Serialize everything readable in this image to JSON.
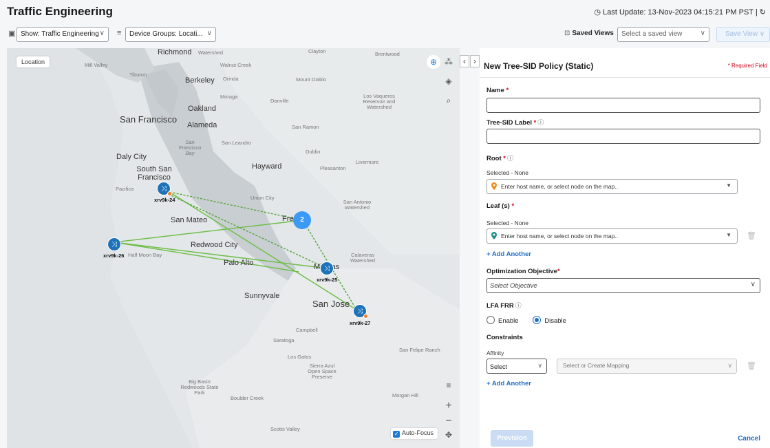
{
  "header": {
    "title": "Traffic Engineering",
    "last_update": "◷ Last Update: 13-Nov-2023 04:15:21 PM PST | ↻"
  },
  "toolbar": {
    "show_filter": "Show: Traffic Engineering",
    "device_groups": "Device Groups: Locati...",
    "saved_views_label": "Saved Views",
    "saved_view_placeholder": "Select a saved view",
    "save_view_button": "Save View"
  },
  "map": {
    "location_chip": "Location",
    "auto_focus": "Auto-Focus",
    "cluster_count": "2",
    "places": [
      {
        "name": "Richmond",
        "size": "med"
      },
      {
        "name": "Watershed",
        "size": "small"
      },
      {
        "name": "Clayton",
        "size": "small"
      },
      {
        "name": "Brentwood",
        "size": "small"
      },
      {
        "name": "Mill Valley",
        "size": "small"
      },
      {
        "name": "Tiburon",
        "size": "small"
      },
      {
        "name": "Walnut Creek",
        "size": "small"
      },
      {
        "name": "Berkeley",
        "size": "med"
      },
      {
        "name": "Orinda",
        "size": "small"
      },
      {
        "name": "Mount Diablo",
        "size": "small"
      },
      {
        "name": "Moraga",
        "size": "small"
      },
      {
        "name": "Danville",
        "size": "small"
      },
      {
        "name": "Los Vaqueros Reservoir and Watershed",
        "size": "small"
      },
      {
        "name": "Oakland",
        "size": "med"
      },
      {
        "name": "San Francisco",
        "size": "big"
      },
      {
        "name": "Alameda",
        "size": "med"
      },
      {
        "name": "San Ramon",
        "size": "small"
      },
      {
        "name": "San Francisco Bay",
        "size": "small"
      },
      {
        "name": "San Leandro",
        "size": "small"
      },
      {
        "name": "Dublin",
        "size": "small"
      },
      {
        "name": "Livermore",
        "size": "small"
      },
      {
        "name": "Daly City",
        "size": "med"
      },
      {
        "name": "South San Francisco",
        "size": "med"
      },
      {
        "name": "Hayward",
        "size": "med"
      },
      {
        "name": "Pleasanton",
        "size": "small"
      },
      {
        "name": "Pacifica",
        "size": "small"
      },
      {
        "name": "Union City",
        "size": "small"
      },
      {
        "name": "San Antonio Watershed",
        "size": "small"
      },
      {
        "name": "San Mateo",
        "size": "med"
      },
      {
        "name": "Fremont",
        "size": "med"
      },
      {
        "name": "Redwood City",
        "size": "med"
      },
      {
        "name": "Half Moon Bay",
        "size": "small"
      },
      {
        "name": "Palo Alto",
        "size": "med"
      },
      {
        "name": "Milpitas",
        "size": "med"
      },
      {
        "name": "Calaveras Watershed",
        "size": "small"
      },
      {
        "name": "Sunnyvale",
        "size": "med"
      },
      {
        "name": "San Jose",
        "size": "big"
      },
      {
        "name": "Campbell",
        "size": "small"
      },
      {
        "name": "Saratoga",
        "size": "small"
      },
      {
        "name": "Los Gatos",
        "size": "small"
      },
      {
        "name": "San Felipe Ranch",
        "size": "small"
      },
      {
        "name": "Sierra Azul Open Space Preserve",
        "size": "small"
      },
      {
        "name": "Big Basin Redwoods State Park",
        "size": "small"
      },
      {
        "name": "Boulder Creek",
        "size": "small"
      },
      {
        "name": "Morgan Hill",
        "size": "small"
      },
      {
        "name": "Scotts Valley",
        "size": "small"
      }
    ],
    "nodes": [
      {
        "id": "xrv9k-24"
      },
      {
        "id": "xrv9k-26"
      },
      {
        "id": "xrv9k-25"
      },
      {
        "id": "xrv9k-27"
      }
    ]
  },
  "panel": {
    "title": "New Tree-SID Policy (Static)",
    "required_note": "* Required Field",
    "name_label": "Name",
    "tree_sid_label": "Tree-SID Label",
    "root_label": "Root",
    "root_selected": "Selected - None",
    "root_placeholder": "Enter host name, or select node on the map..",
    "leaf_label": "Leaf (s)",
    "leaf_selected": "Selected - None",
    "leaf_placeholder": "Enter host name, or select node on the map..",
    "add_another": "+ Add Another",
    "optimization_label": "Optimization Objective",
    "optimization_value": "Select Objective",
    "lfa_label": "LFA FRR",
    "enable": "Enable",
    "disable": "Disable",
    "constraints_label": "Constraints",
    "affinity_label": "Affinity",
    "affinity_select": "Select",
    "mapping_placeholder": "Select or Create Mapping",
    "add_another_2": "+ Add Another",
    "provision": "Provision",
    "cancel": "Cancel"
  },
  "colors": {
    "accent": "#1f6fc4",
    "node": "#1e73b8",
    "required": "#d0021b",
    "link": "#6fbf4a"
  }
}
